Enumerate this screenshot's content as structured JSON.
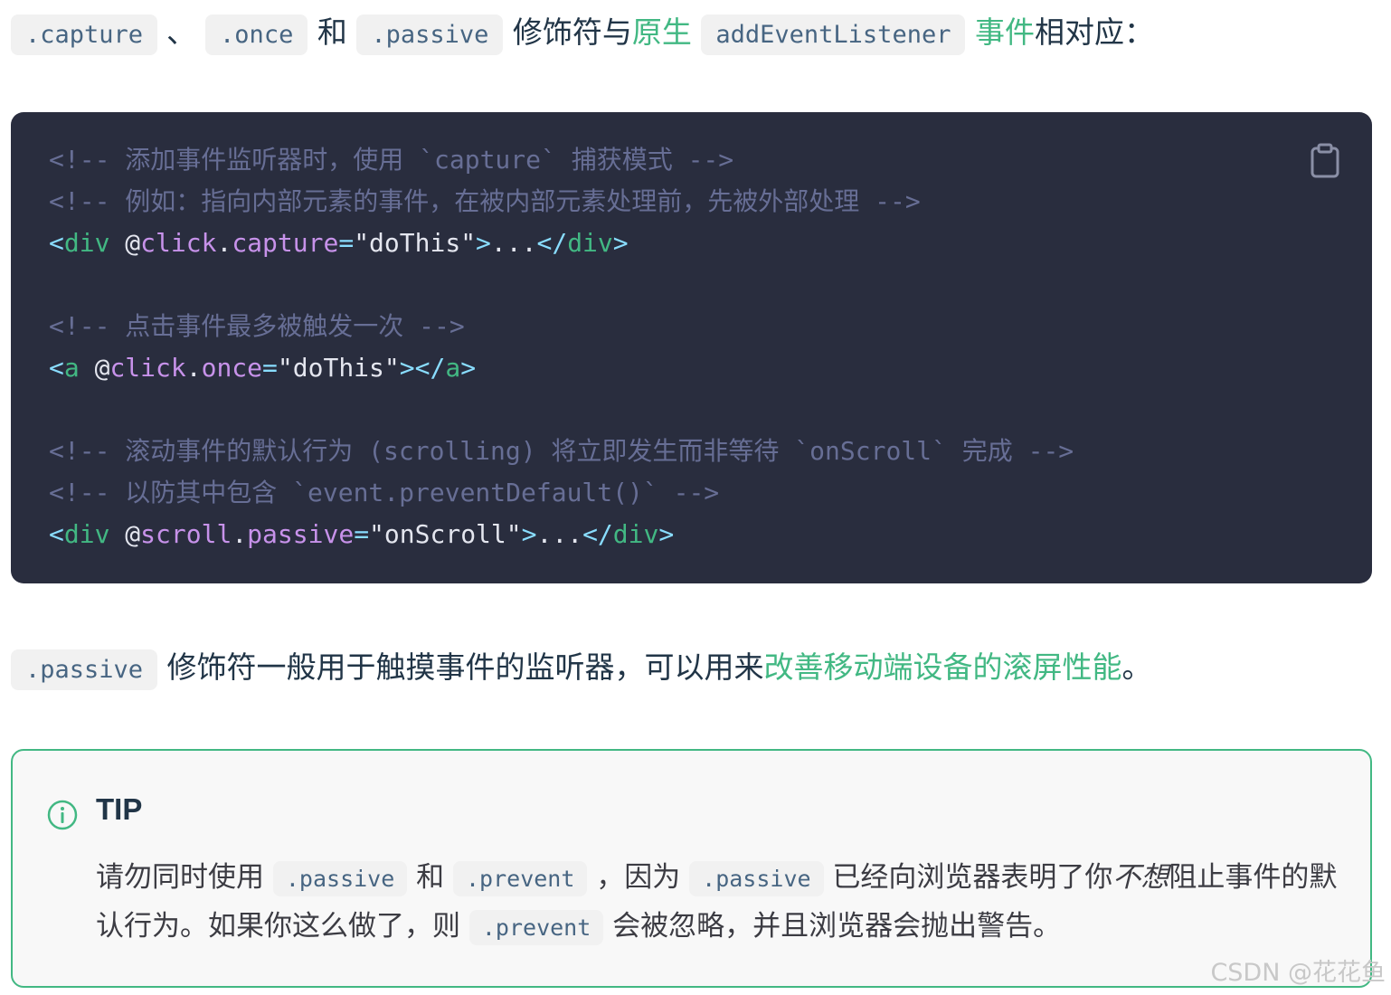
{
  "intro": {
    "code1": ".capture",
    "sep1": "、",
    "code2": ".once",
    "and": "和",
    "code3": ".passive",
    "text1": "修饰符与",
    "link1": "原生",
    "code4": "addEventListener",
    "link2": "事件",
    "text2": "相对应："
  },
  "code_block": {
    "line1": "<!-- 添加事件监听器时，使用 `capture` 捕获模式 -->",
    "line2": "<!-- 例如：指向内部元素的事件，在被内部元素处理前，先被外部处理 -->",
    "line3": {
      "open": "<",
      "tag": "div",
      "at": " @",
      "attr": "click",
      "dot": ".",
      "mod": "capture",
      "eq": "=",
      "str": "\"doThis\"",
      "gt": ">",
      "text": "...",
      "close_open": "</",
      "close_tag": "div",
      "close_gt": ">"
    },
    "line5": "<!-- 点击事件最多被触发一次 -->",
    "line6": {
      "open": "<",
      "tag": "a",
      "at": " @",
      "attr": "click",
      "dot": ".",
      "mod": "once",
      "eq": "=",
      "str": "\"doThis\"",
      "gt": ">",
      "text": "",
      "close_open": "</",
      "close_tag": "a",
      "close_gt": ">"
    },
    "line8": "<!-- 滚动事件的默认行为 (scrolling) 将立即发生而非等待 `onScroll` 完成 -->",
    "line9": "<!-- 以防其中包含 `event.preventDefault()` -->",
    "line10": {
      "open": "<",
      "tag": "div",
      "at": " @",
      "attr": "scroll",
      "dot": ".",
      "mod": "passive",
      "eq": "=",
      "str": "\"onScroll\"",
      "gt": ">",
      "text": "...",
      "close_open": "</",
      "close_tag": "div",
      "close_gt": ">"
    }
  },
  "passive_para": {
    "code": ".passive",
    "text1": "修饰符一般用于触摸事件的监听器，可以用来",
    "link": "改善移动端设备的滚屏性能",
    "text2": "。"
  },
  "tip": {
    "title": "TIP",
    "t1": "请勿同时使用",
    "c1": ".passive",
    "t2": "和",
    "c2": ".prevent",
    "t3": "，因为",
    "c3": ".passive",
    "t4": "已经向浏览器表明了你",
    "em": "不想",
    "t5": "阻止事件的默认行为。如果你这么做了，则",
    "c4": ".prevent",
    "t6": "会被忽略，并且浏览器会抛出警告。"
  },
  "icons": {
    "copy": "clipboard-icon",
    "info": "info-circle-icon"
  },
  "colors": {
    "accent": "#42b883",
    "code_bg": "#292d3e"
  },
  "watermark": "CSDN @花花鱼"
}
